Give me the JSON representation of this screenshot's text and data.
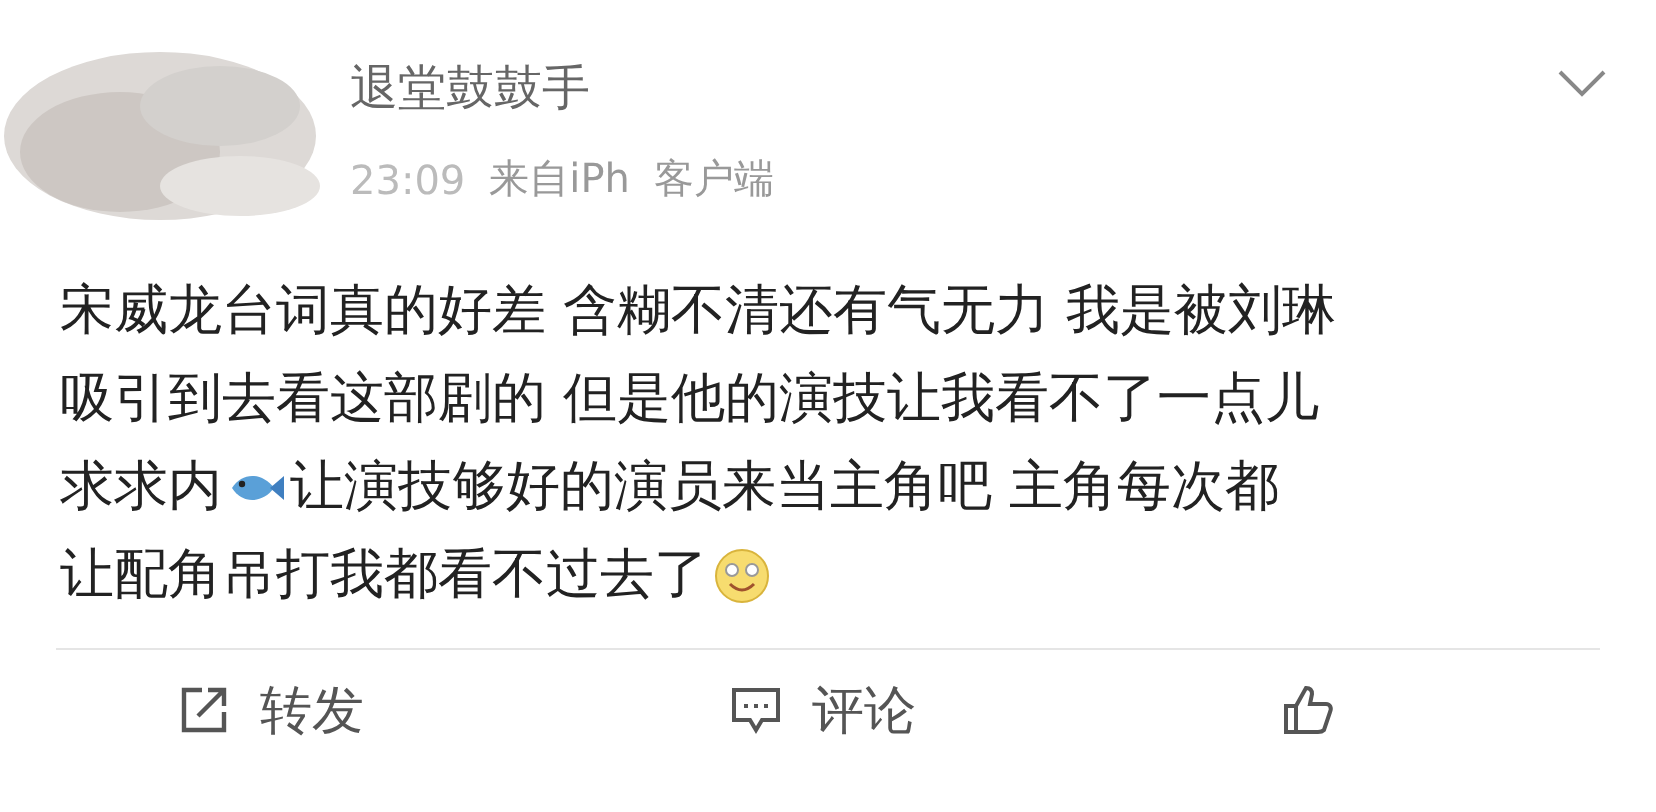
{
  "post": {
    "author": "退堂鼓鼓手",
    "time": "23:09",
    "source_start": "来自iPh",
    "source_end": "客户端",
    "lines": [
      [
        {
          "kind": "text",
          "text": "宋威龙台词真的好差 含糊不清还有气无力 我是被刘琳"
        }
      ],
      [
        {
          "kind": "text",
          "text": "吸引到去看这部剧的 但是他的演技让我看不了一点儿"
        }
      ],
      [
        {
          "kind": "text",
          "text": "求求内"
        },
        {
          "kind": "fish"
        },
        {
          "kind": "text",
          "text": "让演技够好的演员来当主角吧 主角每次都"
        }
      ],
      [
        {
          "kind": "text",
          "text": "让配角吊打我都看不过去了"
        },
        {
          "kind": "smile"
        }
      ]
    ]
  },
  "actions": [
    {
      "kind": "repost",
      "label": "转发"
    },
    {
      "kind": "comment",
      "label": "评论"
    },
    {
      "kind": "like"
    }
  ]
}
